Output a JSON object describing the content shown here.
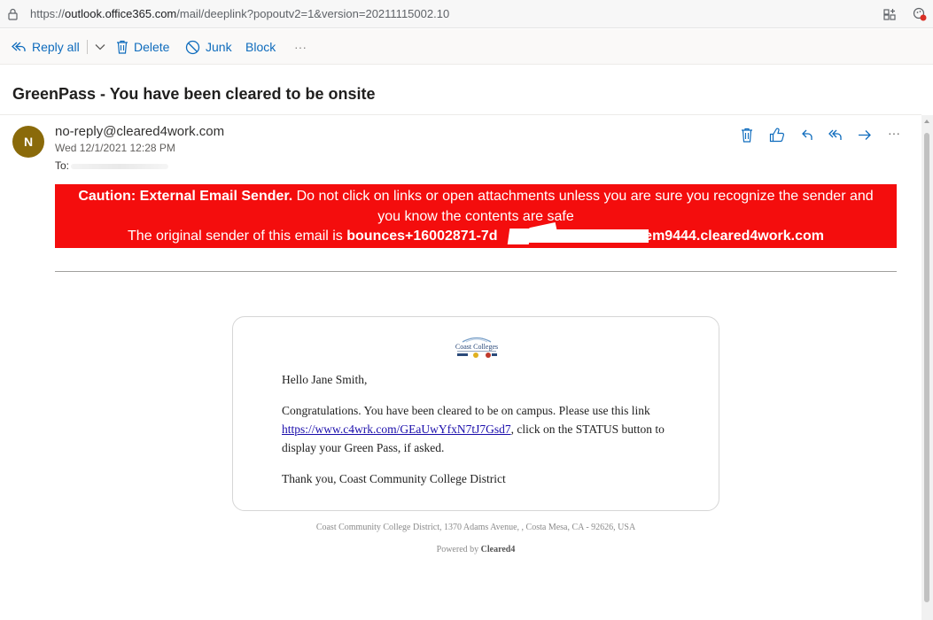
{
  "browser": {
    "url_prefix": "https://",
    "url_host": "outlook.office365.com",
    "url_path": "/mail/deeplink?popoutv2=1&version=20211115002.10"
  },
  "toolbar": {
    "reply_all_label": "Reply all",
    "delete_label": "Delete",
    "junk_label": "Junk",
    "block_label": "Block",
    "more_label": "···"
  },
  "message": {
    "subject": "GreenPass - You have been cleared to be onsite",
    "avatar_initial": "N",
    "avatar_color": "#8a6a0a",
    "from": "no-reply@cleared4work.com",
    "date": "Wed 12/1/2021 12:28 PM",
    "to_label": "To:",
    "more_actions_label": "···"
  },
  "caution": {
    "bg_color": "#f40d0d",
    "title": "Caution: External Email Sender.",
    "text_line1": " Do not click on links or open attachments unless you are sure you recognize the sender and",
    "text_line2": "you know the contents are safe",
    "sender_prefix": "The original sender of this email is ",
    "sender_start": "bounces+16002871-7d",
    "sender_end": "@em9444.cleared4work.com"
  },
  "email_body": {
    "logo_text": "Coast Colleges",
    "greeting": "Hello Jane Smith,",
    "para_before_link": "Congratulations. You have been cleared to be on campus. Please use this link ",
    "link": "https://www.c4wrk.com/GEaUwYfxN7tJ7Gsd7",
    "para_after_link": ", click on the STATUS button to display your Green Pass, if asked.",
    "signoff": "Thank you, Coast Community College District",
    "footer_address": "Coast Community College District, 1370 Adams Avenue, , Costa Mesa, CA - 92626, USA",
    "powered_prefix": "Powered by ",
    "powered_brand": "Cleared4"
  }
}
